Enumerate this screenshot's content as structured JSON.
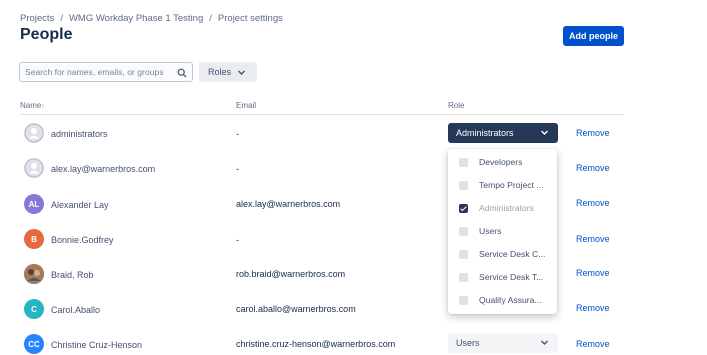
{
  "breadcrumb": {
    "items": [
      "Projects",
      "WMG Workday Phase 1 Testing",
      "Project settings"
    ],
    "separator": "/"
  },
  "page": {
    "title": "People"
  },
  "actions": {
    "add_people": "Add people"
  },
  "search": {
    "placeholder": "Search for names, emails, or groups",
    "icon": "search-icon"
  },
  "filters": {
    "roles_label": "Roles"
  },
  "table": {
    "headers": {
      "name": "Name",
      "sort_indicator": "↑",
      "email": "Email",
      "role": "Role"
    },
    "rows": [
      {
        "name": "administrators",
        "email": "-",
        "avatar_initials": "",
        "avatar_color": "#DFE1E6",
        "role": "Administrators",
        "remove": "Remove"
      },
      {
        "name": "alex.lay@warnerbros.com",
        "email": "-",
        "avatar_initials": "",
        "avatar_color": "#DFE1E6",
        "role": "",
        "remove": "Remove"
      },
      {
        "name": "Alexander Lay",
        "email": "alex.lay@warnerbros.com",
        "avatar_initials": "AL",
        "avatar_color": "#8777D9",
        "role": "",
        "remove": "Remove"
      },
      {
        "name": "Bonnie.Godfrey",
        "email": "-",
        "avatar_initials": "B",
        "avatar_color": "#E56B3E",
        "role": "",
        "remove": "Remove"
      },
      {
        "name": "Braid, Rob",
        "email": "rob.braid@warnerbros.com",
        "avatar_initials": "",
        "avatar_color": "#7A5C44",
        "role": "",
        "remove": "Remove"
      },
      {
        "name": "Carol.Aballo",
        "email": "carol.aballo@warnerbros.com",
        "avatar_initials": "C",
        "avatar_color": "#26B5C4",
        "role": "",
        "remove": "Remove"
      },
      {
        "name": "Christine Cruz-Henson",
        "email": "christine.cruz-henson@warnerbros.com",
        "avatar_initials": "CC",
        "avatar_color": "#2684FF",
        "role": "Users",
        "remove": "Remove"
      }
    ]
  },
  "role_dropdown": {
    "options": [
      {
        "label": "Developers",
        "checked": false
      },
      {
        "label": "Tempo Project ...",
        "checked": false
      },
      {
        "label": "Administrators",
        "checked": true
      },
      {
        "label": "Users",
        "checked": false
      },
      {
        "label": "Service Desk C...",
        "checked": false
      },
      {
        "label": "Service Desk T...",
        "checked": false
      },
      {
        "label": "Quality Assura...",
        "checked": false
      }
    ]
  },
  "colors": {
    "primary": "#0052CC",
    "selected_role_bg": "#253858",
    "link": "#0052CC"
  }
}
